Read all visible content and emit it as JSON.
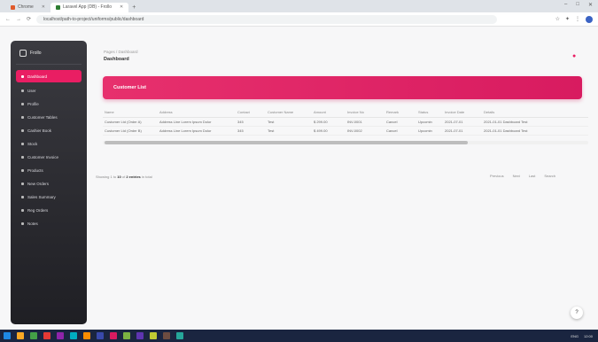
{
  "browser": {
    "tabs": [
      {
        "label": "Chrome",
        "active": false,
        "color": "#e05a2b"
      },
      {
        "label": "Laravel App (DB) - Frollo",
        "active": true,
        "color": "#2e7d32"
      }
    ],
    "new_tab": "+",
    "window_controls": [
      "–",
      "□",
      "✕"
    ],
    "url": "localhost/path-to-project/uniforms/public/dashboard"
  },
  "sidebar": {
    "brand": "Frollo",
    "items": [
      {
        "label": "Dashboard",
        "active": true
      },
      {
        "label": "User",
        "active": false
      },
      {
        "label": "Profile",
        "active": false
      },
      {
        "label": "Customer Tables",
        "active": false
      },
      {
        "label": "Cashier Book",
        "active": false
      },
      {
        "label": "Stock",
        "active": false
      },
      {
        "label": "Customer Invoice",
        "active": false
      },
      {
        "label": "Products",
        "active": false
      },
      {
        "label": "New Orders",
        "active": false
      },
      {
        "label": "Sales Summary",
        "active": false
      },
      {
        "label": "Reg Orders",
        "active": false
      },
      {
        "label": "Notes",
        "active": false
      }
    ]
  },
  "main": {
    "breadcrumb": "Pages / Dashboard",
    "title": "Dashboard",
    "top_icon": "bell-icon",
    "card_title": "Customer List",
    "table": {
      "columns": [
        "Name",
        "Address",
        "Contact",
        "Customer Name",
        "Amount",
        "Invoice No",
        "Remark",
        "Status",
        "Invoice Date",
        "Details"
      ],
      "rows": [
        [
          "Customer Ltd (Order A)",
          "Address Line Lorem Ipsum Dolor",
          "345",
          "Test",
          "$ 299.00",
          "INV-0001",
          "Cancel",
          "Upcomin",
          "2021-07-01",
          "2021-01-01 Dashboard Test"
        ],
        [
          "Customer Ltd (Order B)",
          "Address Line Lorem Ipsum Dolor",
          "345",
          "Test",
          "$ 499.00",
          "INV-0002",
          "Cancel",
          "Upcomin",
          "2021-07-01",
          "2021-01-01 Dashboard Test"
        ]
      ]
    },
    "pagination": {
      "summary_prefix": "Showing 1 to",
      "summary_count": "10",
      "summary_mid": "of",
      "summary_total": "2 entries",
      "summary_suffix": "in total",
      "buttons": [
        "Previous",
        "Next",
        "Last",
        "Search"
      ]
    },
    "fab_label": "?"
  },
  "taskbar": {
    "icons": [
      "#1e88e5",
      "#f9a825",
      "#43a047",
      "#e53935",
      "#8e24aa",
      "#00acc1",
      "#fb8c00",
      "#3949ab",
      "#d81b60",
      "#7cb342",
      "#5e35b1",
      "#c0ca33",
      "#6d4c41",
      "#26a69a"
    ],
    "tray_text": "ENG",
    "time": "12:00"
  }
}
